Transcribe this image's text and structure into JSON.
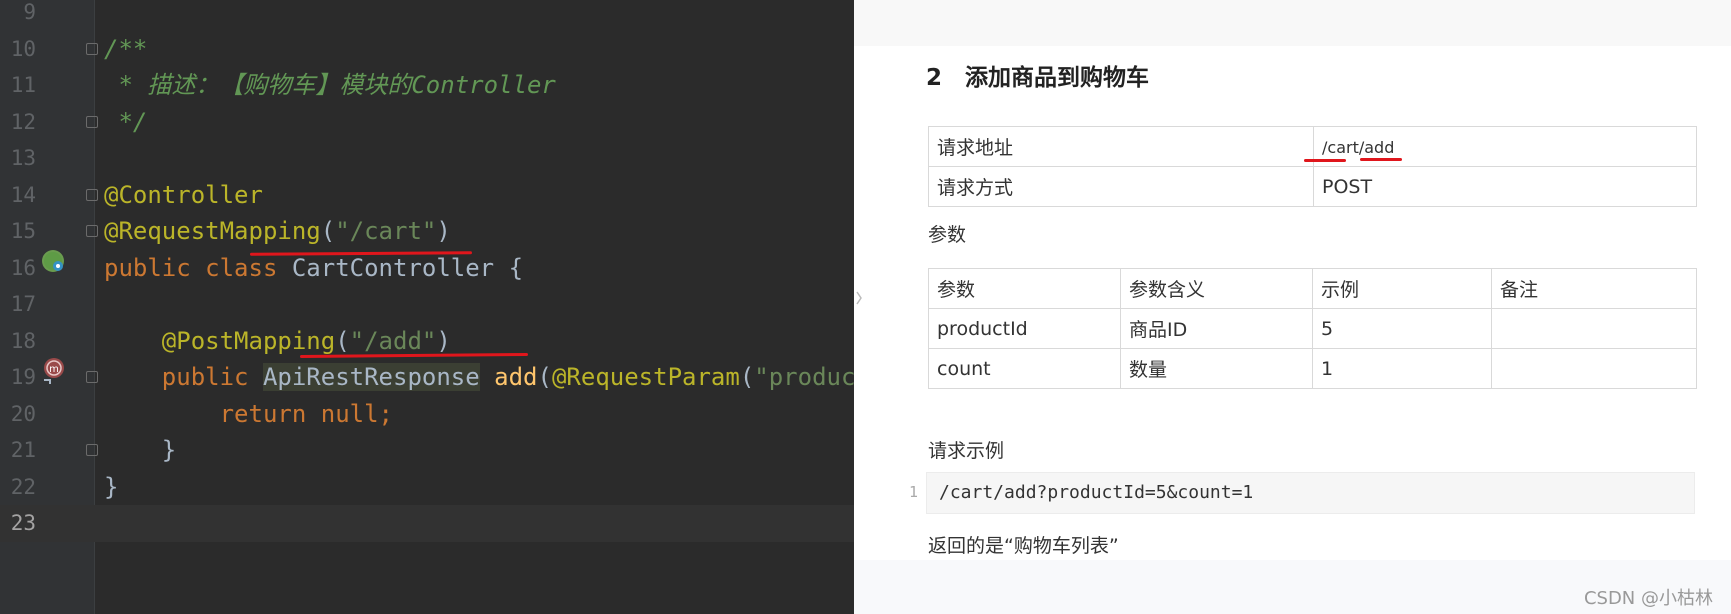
{
  "editor": {
    "lines": [
      {
        "num": "9",
        "tokens": []
      },
      {
        "num": "10",
        "tokens": [
          {
            "c": "doc",
            "t": "/**"
          }
        ]
      },
      {
        "num": "11",
        "tokens": [
          {
            "c": "doc",
            "t": " * 描述：【购物车】模块的Controller"
          }
        ]
      },
      {
        "num": "12",
        "tokens": [
          {
            "c": "doc",
            "t": " */"
          }
        ]
      },
      {
        "num": "13",
        "tokens": []
      },
      {
        "num": "14",
        "tokens": [
          {
            "c": "ann",
            "t": "@Controller"
          }
        ]
      },
      {
        "num": "15",
        "tokens": [
          {
            "c": "ann",
            "t": "@RequestMapping"
          },
          {
            "c": "",
            "t": "("
          },
          {
            "c": "str",
            "t": "\"/cart\""
          },
          {
            "c": "",
            "t": ")"
          }
        ]
      },
      {
        "num": "16",
        "tokens": [
          {
            "c": "kw",
            "t": "public class "
          },
          {
            "c": "",
            "t": "CartController {"
          }
        ]
      },
      {
        "num": "17",
        "tokens": []
      },
      {
        "num": "18",
        "tokens": [
          {
            "c": "",
            "t": "    "
          },
          {
            "c": "ann",
            "t": "@PostMapping"
          },
          {
            "c": "",
            "t": "("
          },
          {
            "c": "str",
            "t": "\"/add\""
          },
          {
            "c": "",
            "t": ")"
          }
        ]
      },
      {
        "num": "19",
        "tokens": [
          {
            "c": "",
            "t": "    "
          },
          {
            "c": "kw",
            "t": "public "
          },
          {
            "c": "hl-type",
            "t": "ApiRestResponse"
          },
          {
            "c": "",
            "t": " "
          },
          {
            "c": "ann2",
            "t": "add"
          },
          {
            "c": "",
            "t": "("
          },
          {
            "c": "ann",
            "t": "@RequestParam"
          },
          {
            "c": "",
            "t": "("
          },
          {
            "c": "str",
            "t": "\"productId"
          }
        ]
      },
      {
        "num": "20",
        "tokens": [
          {
            "c": "",
            "t": "        "
          },
          {
            "c": "kw",
            "t": "return null;"
          }
        ]
      },
      {
        "num": "21",
        "tokens": [
          {
            "c": "",
            "t": "    }"
          }
        ]
      },
      {
        "num": "22",
        "tokens": [
          {
            "c": "",
            "t": "}"
          }
        ]
      },
      {
        "num": "23",
        "tokens": []
      }
    ],
    "current_line": "23",
    "colors": {
      "background": "#2b2b2b",
      "keyword": "#cc7832",
      "annotation": "#bbb529",
      "string": "#6a8759",
      "comment": "#629755",
      "underline": "#e0161c"
    }
  },
  "doc": {
    "section_title": "2　添加商品到购物车",
    "info_table": [
      {
        "key": "请求地址",
        "value": "/cart/add"
      },
      {
        "key": "请求方式",
        "value": "POST"
      }
    ],
    "params_label": "参数",
    "params_headers": [
      "参数",
      "参数含义",
      "示例",
      "备注"
    ],
    "params_rows": [
      [
        "productId",
        "商品ID",
        "5",
        ""
      ],
      [
        "count",
        "数量",
        "1",
        ""
      ]
    ],
    "request_example_label": "请求示例",
    "request_example_line_no": "1",
    "request_example": "/cart/add?productId=5&count=1",
    "return_text": "返回的是“购物车列表”",
    "watermark": "CSDN @小枯林"
  }
}
